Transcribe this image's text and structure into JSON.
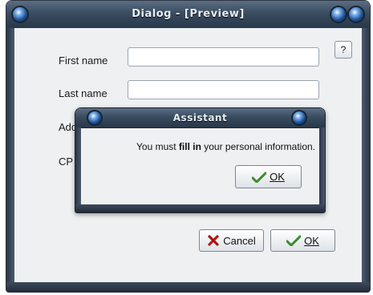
{
  "window": {
    "title": "Dialog - [Preview]",
    "help_label": "?"
  },
  "form": {
    "first_name_label": "First name",
    "last_name_label": "Last name",
    "address_label_visible": "Add",
    "cp_label_visible": "CP",
    "first_name_value": "",
    "last_name_value": ""
  },
  "buttons": {
    "cancel_label": "Cancel",
    "ok_label": "OK"
  },
  "assistant": {
    "title": "Assistant",
    "message_prefix": "You must ",
    "message_bold": "fill in",
    "message_suffix": " your personal information.",
    "ok_label": "OK"
  },
  "icons": {
    "check": "check-icon",
    "cancel": "x-icon",
    "orb": "orb-icon"
  },
  "colors": {
    "titlebar": "#3a4c60",
    "cancel_x": "#b01818",
    "check_green": "#3c8a2c"
  }
}
